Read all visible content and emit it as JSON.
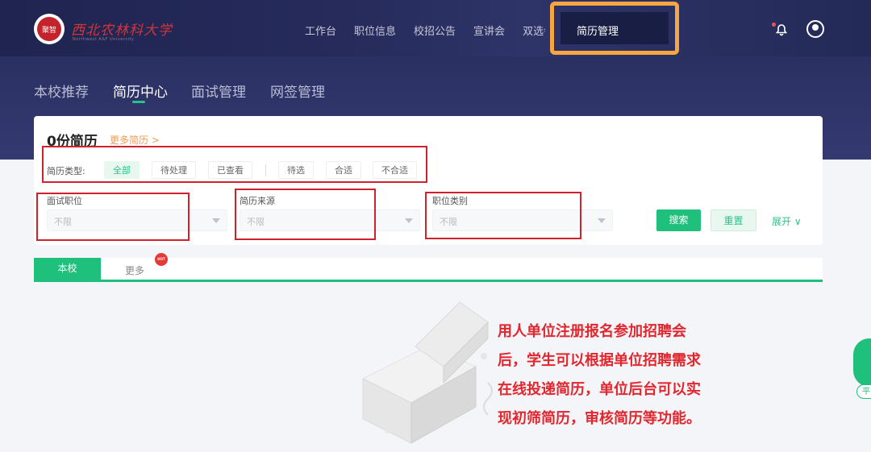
{
  "header": {
    "logo_badge_text": "聚智",
    "school_name": "西北农林科大学",
    "school_sub": "Northwest A&F University",
    "menu": [
      "工作台",
      "职位信息",
      "校招公告",
      "宣讲会",
      "双选会"
    ],
    "active_menu": "简历管理"
  },
  "subnav": {
    "tabs": [
      "本校推荐",
      "简历中心",
      "面试管理",
      "网签管理"
    ],
    "active": "简历中心"
  },
  "resume": {
    "count_label": "0份简历",
    "more_link": "更多简历 >",
    "type_label": "简历类型:",
    "types": [
      "全部",
      "待处理",
      "已查看",
      "待选",
      "合适",
      "不合适"
    ],
    "active_type": "全部"
  },
  "filters": {
    "position": {
      "label": "面试职位",
      "placeholder": "不限"
    },
    "source": {
      "label": "简历来源",
      "placeholder": "不限"
    },
    "category": {
      "label": "职位类别",
      "placeholder": "不限"
    },
    "search_button": "搜索",
    "reset_button": "重置",
    "expand": "展开 ∨"
  },
  "scope_tabs": {
    "items": [
      "本校",
      "更多"
    ],
    "hot_badge": "HOT"
  },
  "description": "用人单位注册报名参加招聘会后，学生可以根据单位招聘需求在线投递简历，单位后台可以实现初筛简历，审核简历等功能。",
  "float_label": "平",
  "colors": {
    "accent_green": "#1fc07c",
    "highlight_orange": "#f7a642",
    "annotation_red": "#d0222c",
    "nav_dark": "#262b5c"
  }
}
